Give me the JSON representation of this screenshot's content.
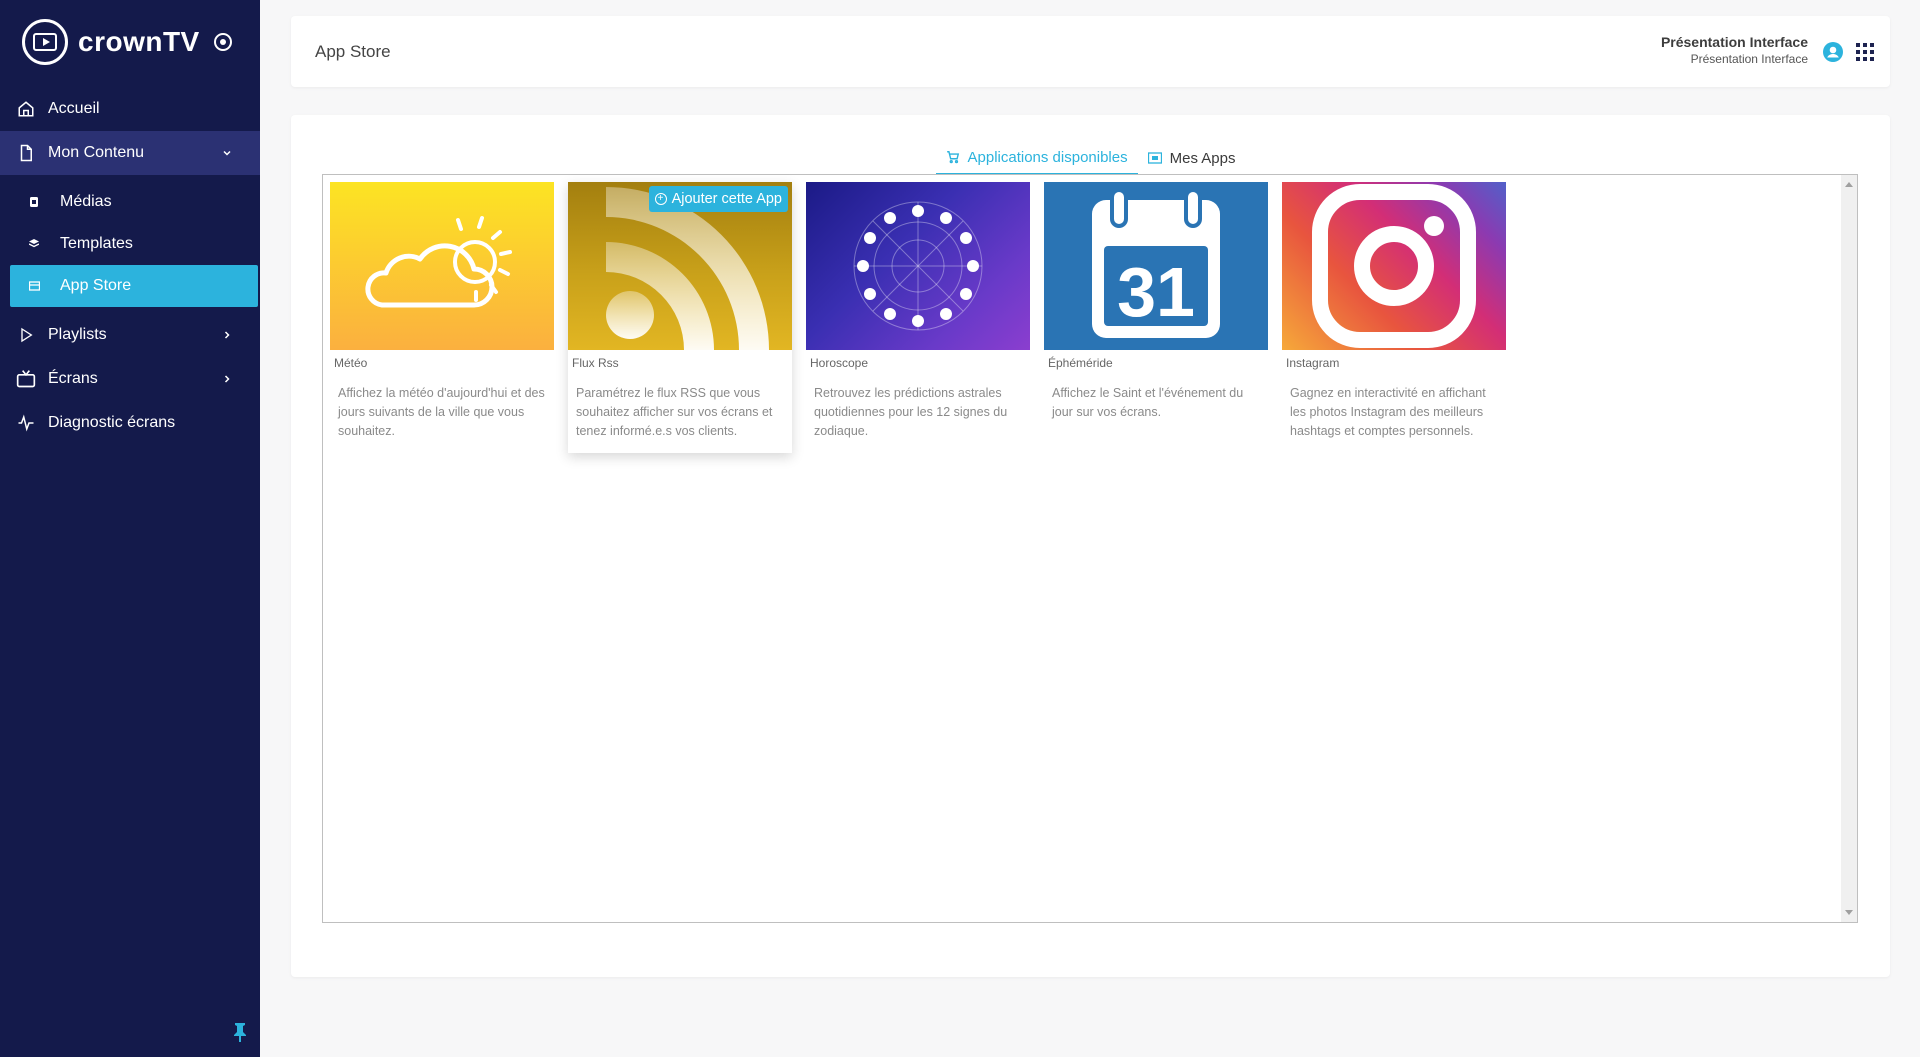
{
  "brand": {
    "name": "crownTV"
  },
  "sidebar": {
    "items": [
      {
        "label": "Accueil",
        "icon": "home-icon"
      },
      {
        "label": "Mon Contenu",
        "icon": "document-icon",
        "expanded": true
      },
      {
        "label": "Médias",
        "icon": "media-icon",
        "sub": true
      },
      {
        "label": "Templates",
        "icon": "templates-icon",
        "sub": true
      },
      {
        "label": "App Store",
        "icon": "store-icon",
        "sub": true,
        "active": true
      },
      {
        "label": "Playlists",
        "icon": "play-icon"
      },
      {
        "label": "Écrans",
        "icon": "tv-icon"
      },
      {
        "label": "Diagnostic écrans",
        "icon": "pulse-icon"
      }
    ]
  },
  "header": {
    "title": "App Store",
    "user_name": "Présentation Interface",
    "user_sub": "Présentation Interface"
  },
  "tabs": [
    {
      "label": "Applications disponibles",
      "icon": "cart-icon",
      "active": true
    },
    {
      "label": "Mes Apps",
      "icon": "app-icon",
      "active": false
    }
  ],
  "apps": [
    {
      "name": "Météo",
      "description": "Affichez la météo d'aujourd'hui et des jours suivants de la ville que vous souhaitez.",
      "icon": "weather-icon"
    },
    {
      "name": "Flux Rss",
      "description": "Paramétrez le flux RSS que vous souhaitez afficher sur vos écrans et tenez informé.e.s vos clients.",
      "icon": "rss-icon",
      "action_label": "Ajouter cette App"
    },
    {
      "name": "Horoscope",
      "description": "Retrouvez les prédictions astrales quotidiennes pour les 12 signes du zodiaque.",
      "icon": "zodiac-icon"
    },
    {
      "name": "Éphéméride",
      "description": "Affichez le Saint et l'événement du jour sur vos écrans.",
      "icon": "calendar-icon",
      "calendar_day": "31"
    },
    {
      "name": "Instagram",
      "description": "Gagnez en interactivité en affichant les photos Instagram des meilleurs hashtags et comptes personnels.",
      "icon": "instagram-icon"
    }
  ],
  "colors": {
    "sidebar": "#141a4b",
    "accent": "#2cb3dd",
    "group_bg": "#2b3173"
  }
}
